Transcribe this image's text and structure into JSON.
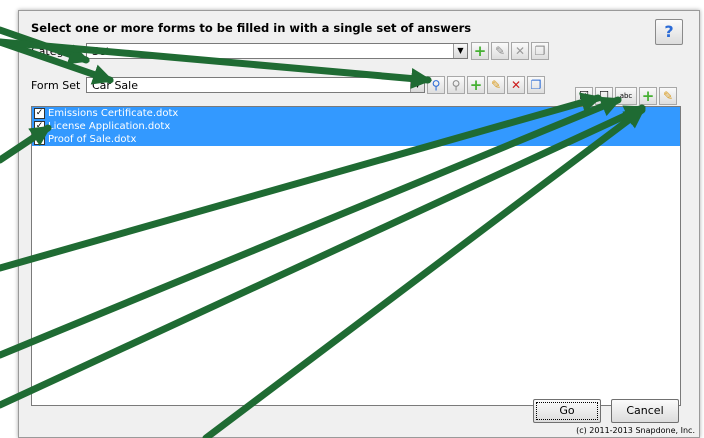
{
  "dialog": {
    "title": "Select one or more forms to be filled in with a single set of answers",
    "help_label": "?",
    "category": {
      "label": "Category",
      "value": "Sets"
    },
    "form_set": {
      "label": "Form Set",
      "value": "Car Sale"
    },
    "list_toolbar": {
      "abc_label": "abc"
    },
    "forms": [
      {
        "name": "Emissions Certificate.dotx",
        "checked": true
      },
      {
        "name": "License Application.dotx",
        "checked": true
      },
      {
        "name": "Proof of Sale.dotx",
        "checked": true
      }
    ],
    "go_label": "Go",
    "cancel_label": "Cancel",
    "copyright": "(c) 2011-2013 Snapdone, Inc."
  },
  "colors": {
    "selection": "#3399ff",
    "annotation_arrow": "#1f6b33",
    "dialog_bg": "#f0f0f0"
  },
  "icons": [
    "help-icon",
    "dropdown-icon",
    "add-icon",
    "edit-icon",
    "delete-icon",
    "copy-icon",
    "search-icon",
    "check-all-icon",
    "uncheck-all-icon"
  ]
}
